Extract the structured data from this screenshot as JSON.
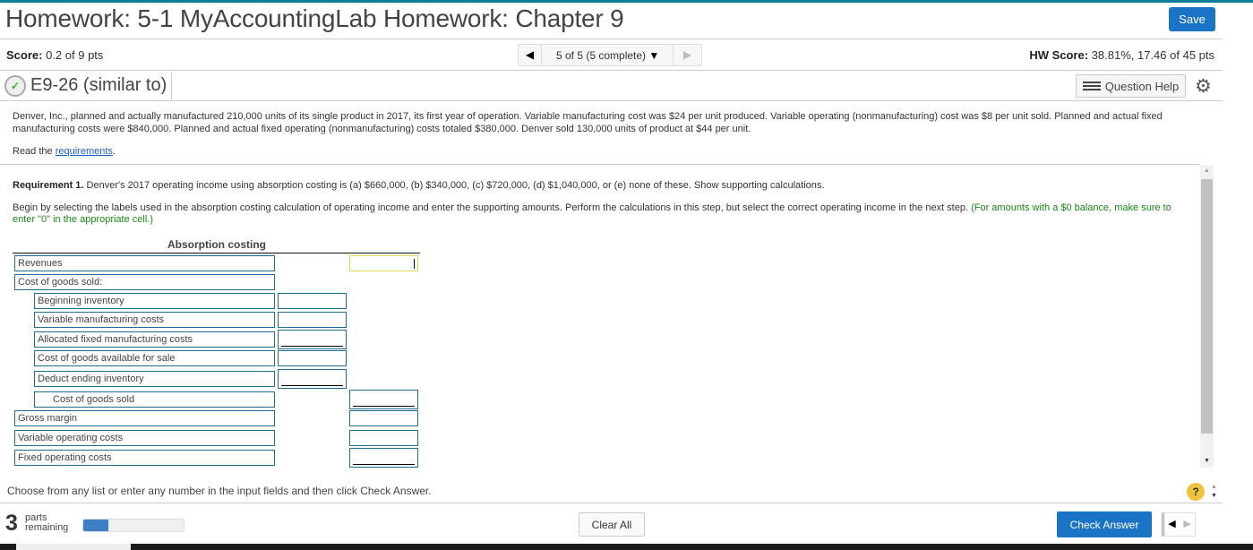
{
  "header": {
    "title": "Homework: 5-1 MyAccountingLab Homework: Chapter 9",
    "save_label": "Save"
  },
  "score_bar": {
    "score_label": "Score:",
    "score_value": "0.2 of 9 pts",
    "nav_label": "5 of 5 (5 complete)",
    "hw_label": "HW Score:",
    "hw_value": "38.81%, 17.46 of 45 pts"
  },
  "question": {
    "id": "E9-26 (similar to)",
    "help_label": "Question Help",
    "status_icon": "partial-credit-icon"
  },
  "problem": {
    "text": "Denver, Inc., planned and actually manufactured 210,000 units of its single product in 2017, its first year of operation. Variable manufacturing cost was $24 per unit produced. Variable operating (nonmanufacturing) cost was $8 per unit sold. Planned and actual fixed manufacturing costs were $840,000. Planned and actual fixed operating (nonmanufacturing) costs totaled $380,000. Denver sold 130,000 units of product at $44 per unit.",
    "read_prefix": "Read the ",
    "read_link": "requirements",
    "read_suffix": "."
  },
  "requirement": {
    "title": "Requirement 1.",
    "text": " Denver's 2017 operating income using absorption costing is (a) $660,000, (b) $340,000, (c) $720,000, (d) $1,040,000, or (e) none of these. Show supporting calculations.",
    "instructions": "Begin by selecting the labels used in the absorption costing calculation of operating income and enter the supporting amounts. Perform the calculations in this step, but select the correct operating income in the next step. ",
    "note": "(For amounts with a $0 balance, make sure to enter \"0\" in the appropriate cell.)"
  },
  "table": {
    "heading": "Absorption costing",
    "rows": [
      {
        "label": "Revenues",
        "mid": "",
        "right": ""
      },
      {
        "label": "Cost of goods sold:"
      },
      {
        "label": "Beginning inventory",
        "mid": ""
      },
      {
        "label": "Variable manufacturing costs",
        "mid": ""
      },
      {
        "label": "Allocated fixed manufacturing costs",
        "mid": ""
      },
      {
        "label": "Cost of goods available for sale",
        "mid": ""
      },
      {
        "label": "Deduct ending inventory",
        "mid": ""
      },
      {
        "label": "Cost of goods sold",
        "right": ""
      },
      {
        "label": "Gross margin",
        "right": ""
      },
      {
        "label": "Variable operating costs",
        "right": ""
      },
      {
        "label": "Fixed operating costs",
        "right": ""
      }
    ]
  },
  "footer": {
    "instruction": "Choose from any list or enter any number in the input fields and then click Check Answer.",
    "parts_count": "3",
    "parts_label_1": "parts",
    "parts_label_2": "remaining",
    "progress_fraction": 0.25,
    "clear_label": "Clear All",
    "check_label": "Check Answer",
    "help_glyph": "?"
  },
  "colors": {
    "accent": "#1a73c5",
    "top_border": "#0e7c99",
    "input_border": "#1f6e8c",
    "note_green": "#188a18",
    "active_input": "#e8d25a"
  }
}
